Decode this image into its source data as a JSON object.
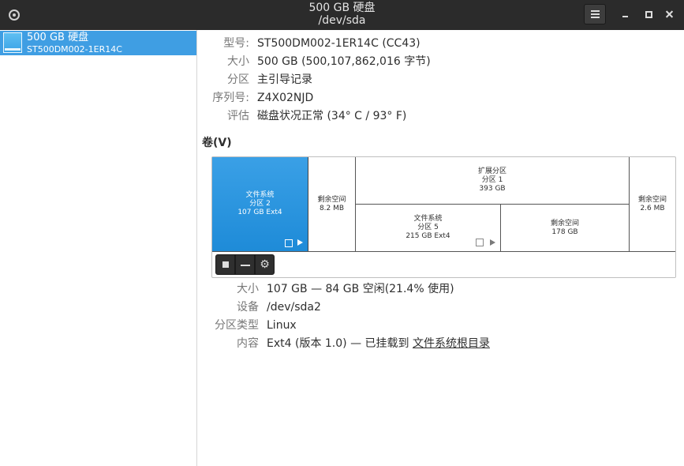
{
  "window": {
    "title_line1": "500 GB 硬盘",
    "title_line2": "/dev/sda"
  },
  "sidebar": {
    "items": [
      {
        "name": "500 GB 硬盘",
        "model": "ST500DM002-1ER14C",
        "icon": "hard-disk-icon",
        "selected": true
      }
    ]
  },
  "drive": {
    "model_label": "型号:",
    "model_value": "ST500DM002-1ER14C (CC43)",
    "size_label": "大小",
    "size_value": "500 GB (500,107,862,016 字节)",
    "partitioning_label": "分区",
    "partitioning_value": "主引导记录",
    "serial_label": "序列号:",
    "serial_value": "Z4X02NJD",
    "assessment_label": "评估",
    "assessment_value": "磁盘状况正常 (34° C / 93° F)"
  },
  "volumes": {
    "section_title": "卷(V)",
    "segments": {
      "p2": {
        "line1": "文件系统",
        "line2": "分区 2",
        "line3": "107 GB Ext4"
      },
      "free1": {
        "line1": "剩余空间",
        "line2": "8.2 MB"
      },
      "ext": {
        "line1": "扩展分区",
        "line2": "分区 1",
        "line3": "393 GB"
      },
      "p5": {
        "line1": "文件系统",
        "line2": "分区 5",
        "line3": "215 GB Ext4"
      },
      "free2": {
        "line1": "剩余空间",
        "line2": "178 GB"
      },
      "free3": {
        "line1": "剩余空间",
        "line2": "2.6 MB"
      }
    },
    "toolbar": {
      "stop_icon": "stop-icon",
      "delete_icon": "minus-icon",
      "settings_icon": "gear-icon",
      "gear_glyph": "⚙"
    }
  },
  "selected_volume": {
    "size_label": "大小",
    "size_value": "107 GB — 84 GB 空闲(21.4% 使用)",
    "device_label": "设备",
    "device_value": "/dev/sda2",
    "type_label": "分区类型",
    "type_value": "Linux",
    "contents_label": "内容",
    "contents_prefix": "Ext4 (版本 1.0) — 已挂载到 ",
    "contents_link": "文件系统根目录"
  },
  "colors": {
    "accent": "#3f9ee3",
    "titlebar": "#2b2b2b"
  }
}
